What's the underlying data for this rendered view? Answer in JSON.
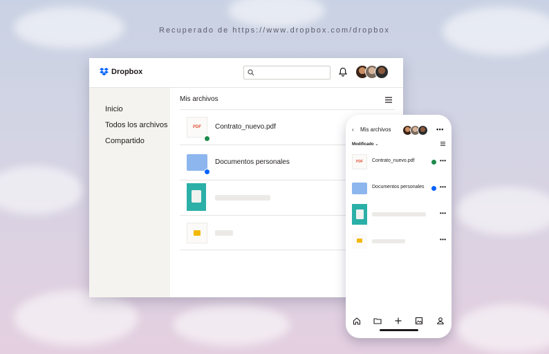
{
  "caption": "Recuperado de https://www.dropbox.com/dropbox",
  "desktop": {
    "brand": "Dropbox",
    "search": {
      "value": "",
      "placeholder": ""
    },
    "sidebar": [
      "Inicio",
      "Todos los archivos",
      "Compartido"
    ],
    "section_title": "Mis archivos",
    "files": [
      {
        "name": "Contrato_nuevo.pdf",
        "type": "pdf",
        "thumb_label": "PDF",
        "status": "synced"
      },
      {
        "name": "Documentos personales",
        "type": "folder",
        "status": "syncing"
      },
      {
        "name": "",
        "type": "image",
        "status": "none"
      },
      {
        "name": "",
        "type": "slides",
        "status": "none"
      }
    ]
  },
  "mobile": {
    "title": "Mis archivos",
    "sort_label": "Modificado",
    "files": [
      {
        "name": "Contrato_nuevo.pdf",
        "type": "pdf",
        "thumb_label": "PDF",
        "status": "synced"
      },
      {
        "name": "Documentos personales",
        "type": "folder",
        "status": "syncing"
      },
      {
        "name": "",
        "type": "image",
        "status": "none"
      },
      {
        "name": "",
        "type": "slides",
        "status": "none"
      }
    ],
    "more_label": "•••",
    "nav_icons": [
      "home-icon",
      "folder-icon",
      "plus-icon",
      "photos-icon",
      "account-icon"
    ]
  },
  "colors": {
    "brand": "#0061fe",
    "synced": "#1e8a4c",
    "syncing": "#0061fe",
    "folder": "#8db6ee",
    "sidebar_bg": "#f5f3ef"
  }
}
